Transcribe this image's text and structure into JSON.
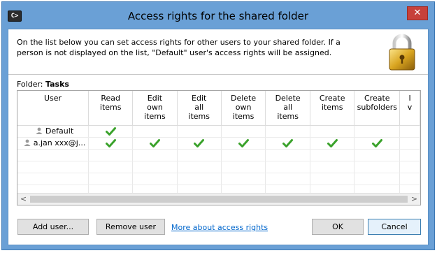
{
  "window": {
    "title": "Access rights for the shared folder",
    "close_glyph": "✕",
    "app_icon_text": "C>"
  },
  "intro": "On the list below you can set access rights for other users to your shared folder. If a person is not displayed on the list, \"Default\" user's access rights will be assigned.",
  "folder": {
    "label": "Folder:",
    "name": "Tasks"
  },
  "table": {
    "columns": [
      {
        "id": "user",
        "lines": [
          "User"
        ]
      },
      {
        "id": "read_items",
        "lines": [
          "Read",
          "items"
        ]
      },
      {
        "id": "edit_own_items",
        "lines": [
          "Edit",
          "own",
          "items"
        ]
      },
      {
        "id": "edit_all_items",
        "lines": [
          "Edit",
          "all",
          "items"
        ]
      },
      {
        "id": "delete_own_items",
        "lines": [
          "Delete",
          "own",
          "items"
        ]
      },
      {
        "id": "delete_all_items",
        "lines": [
          "Delete",
          "all",
          "items"
        ]
      },
      {
        "id": "create_items",
        "lines": [
          "Create",
          "items"
        ]
      },
      {
        "id": "create_subfolders",
        "lines": [
          "Create",
          "subfolders"
        ]
      },
      {
        "id": "partial",
        "lines": [
          "I",
          "v"
        ]
      }
    ],
    "rows": [
      {
        "user": "Default",
        "rights": [
          true,
          false,
          false,
          false,
          false,
          false,
          false,
          false
        ]
      },
      {
        "user": "a.jan xxx@j...",
        "rights": [
          true,
          true,
          true,
          true,
          true,
          true,
          true,
          false
        ]
      }
    ],
    "empty_rows": 5
  },
  "scrollbar": {
    "left_arrow": "<",
    "right_arrow": ">"
  },
  "buttons": {
    "add_user": "Add user...",
    "remove_user": "Remove user",
    "more_about": "More about access rights",
    "ok": "OK",
    "cancel": "Cancel"
  },
  "colors": {
    "title_bar": "#6aa0d6",
    "check_green": "#3aa22b",
    "link": "#0066cc",
    "close_red": "#c7413a"
  },
  "icons": {
    "app": "console-icon",
    "lock": "padlock-icon",
    "user": "user-icon",
    "check": "checkmark-icon"
  }
}
